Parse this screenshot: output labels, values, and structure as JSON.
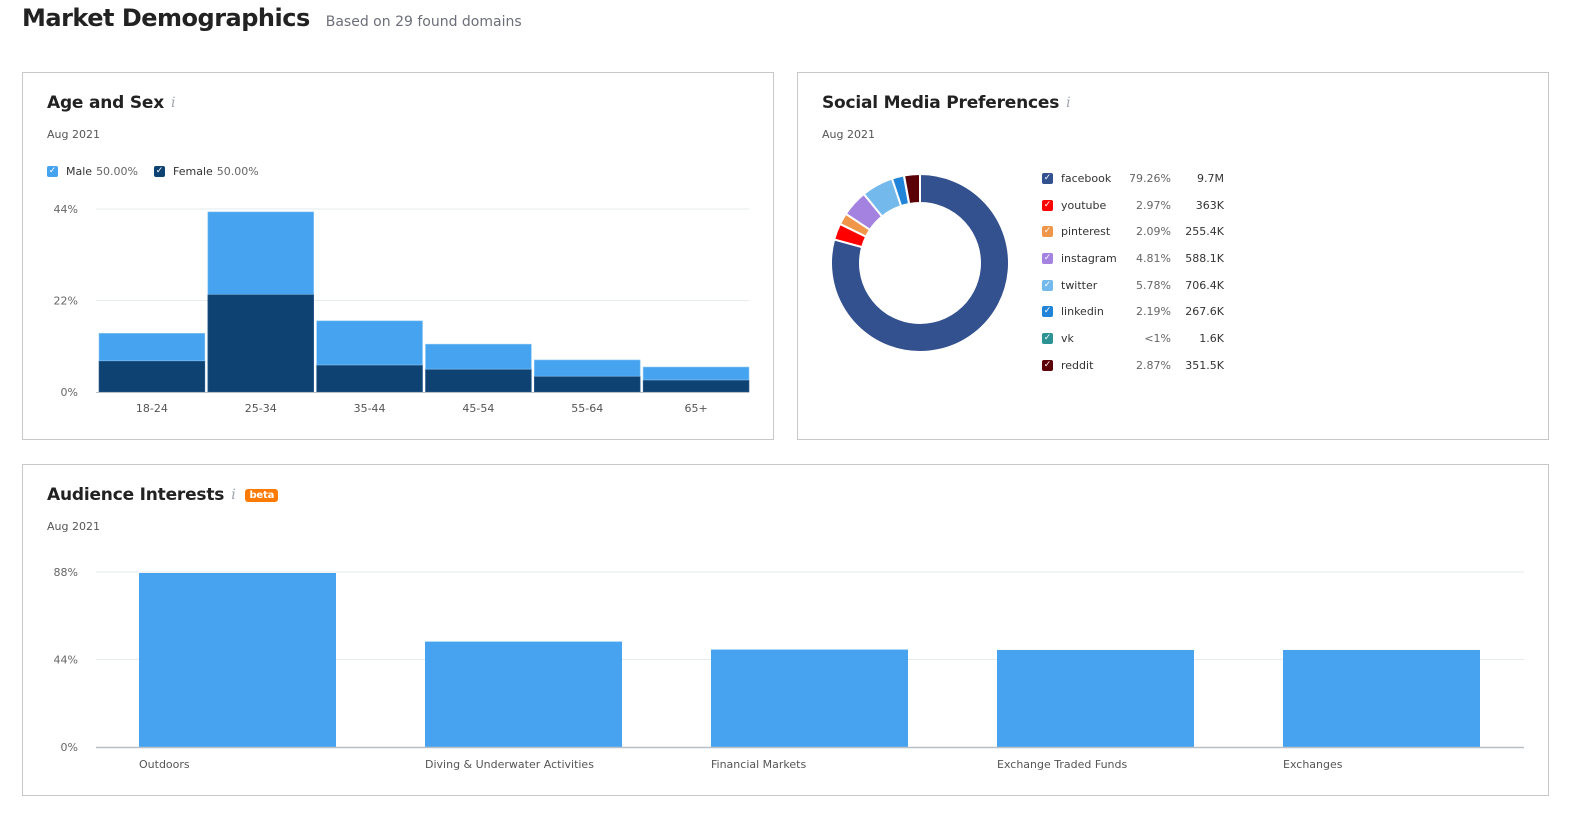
{
  "header": {
    "title": "Market Demographics",
    "subtitle": "Based on 29 found domains"
  },
  "age_sex": {
    "title": "Age and Sex",
    "info_icon": "info-icon",
    "date": "Aug 2021",
    "legend": [
      {
        "label": "Male",
        "value": "50.00%",
        "color": "#45a3ef",
        "checked": true
      },
      {
        "label": "Female",
        "value": "50.00%",
        "color": "#0e4272",
        "checked": true
      }
    ]
  },
  "social": {
    "title": "Social Media Preferences",
    "info_icon": "info-icon",
    "date": "Aug 2021",
    "items": [
      {
        "name": "facebook",
        "pct": "79.26%",
        "count": "9.7M",
        "color": "#33508f"
      },
      {
        "name": "youtube",
        "pct": "2.97%",
        "count": "363K",
        "color": "#ff0000"
      },
      {
        "name": "pinterest",
        "pct": "2.09%",
        "count": "255.4K",
        "color": "#f0964b"
      },
      {
        "name": "instagram",
        "pct": "4.81%",
        "count": "588.1K",
        "color": "#a482e0"
      },
      {
        "name": "twitter",
        "pct": "5.78%",
        "count": "706.4K",
        "color": "#74b9ec"
      },
      {
        "name": "linkedin",
        "pct": "2.19%",
        "count": "267.6K",
        "color": "#2184d8"
      },
      {
        "name": "vk",
        "pct": "<1%",
        "count": "1.6K",
        "color": "#2d9294"
      },
      {
        "name": "reddit",
        "pct": "2.87%",
        "count": "351.5K",
        "color": "#5c0007"
      }
    ]
  },
  "interests": {
    "title": "Audience Interests",
    "info_icon": "info-icon",
    "badge": "beta",
    "date": "Aug 2021"
  },
  "chart_data": [
    {
      "type": "bar",
      "stacked": true,
      "title": "Age and Sex",
      "categories": [
        "18-24",
        "25-34",
        "35-44",
        "45-54",
        "55-64",
        "65+"
      ],
      "series": [
        {
          "name": "Female",
          "color": "#0e4272",
          "values": [
            7.5,
            23.5,
            6.5,
            5.5,
            3.8,
            2.9
          ]
        },
        {
          "name": "Male",
          "color": "#45a3ef",
          "values": [
            6.6,
            19.8,
            10.6,
            6.0,
            3.9,
            3.1
          ]
        }
      ],
      "yticks": [
        "0%",
        "22%",
        "44%"
      ],
      "ylim": [
        0,
        44
      ],
      "grid": true,
      "legend": "top-left"
    },
    {
      "type": "pie",
      "donut": true,
      "title": "Social Media Preferences",
      "labels": [
        "facebook",
        "youtube",
        "pinterest",
        "instagram",
        "twitter",
        "linkedin",
        "vk",
        "reddit"
      ],
      "values": [
        79.26,
        2.97,
        2.09,
        4.81,
        5.78,
        2.19,
        0.03,
        2.87
      ],
      "colors": [
        "#33508f",
        "#ff0000",
        "#f0964b",
        "#a482e0",
        "#74b9ec",
        "#2184d8",
        "#2d9294",
        "#5c0007"
      ],
      "legend": "right"
    },
    {
      "type": "bar",
      "title": "Audience Interests",
      "categories": [
        "Outdoors",
        "Diving & Underwater Activities",
        "Financial Markets",
        "Exchange Traded Funds",
        "Exchanges"
      ],
      "values": [
        87.5,
        53,
        49,
        48.8,
        48.8
      ],
      "color": "#47a3f0",
      "yticks": [
        "0%",
        "44%",
        "88%"
      ],
      "ylim": [
        0,
        88
      ],
      "grid": true
    }
  ]
}
